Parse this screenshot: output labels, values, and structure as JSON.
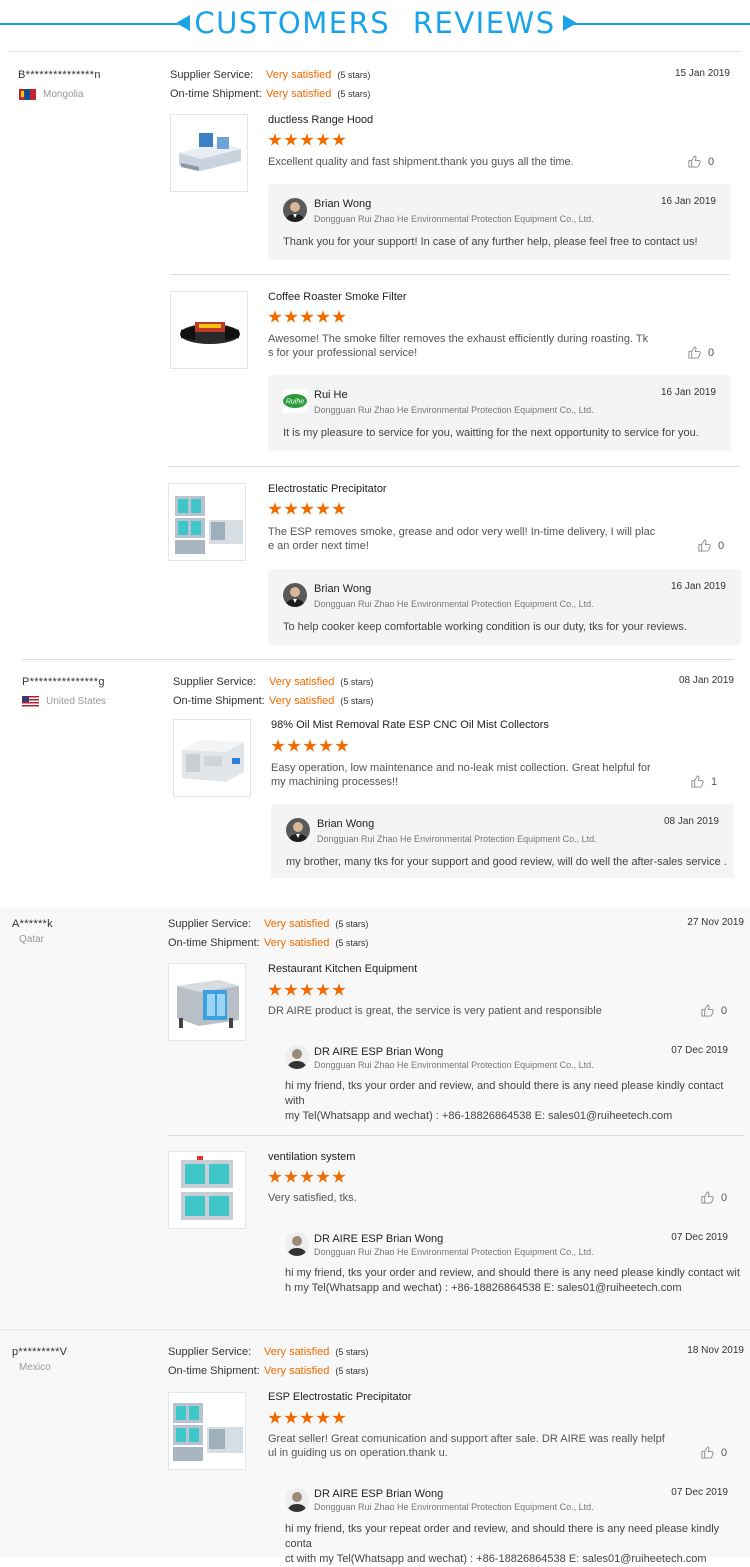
{
  "header": {
    "title": "CUSTOMERS  REVIEWS"
  },
  "labels": {
    "supplier_service": "Supplier Service:",
    "ontime_shipment": "On-time Shipment:",
    "very_satisfied": "Very satisfied",
    "five_stars": "(5 stars)"
  },
  "colors": {
    "accent_blue": "#1aa3e8",
    "accent_orange": "#ef6b00"
  },
  "reviews": [
    {
      "name": "B***************n",
      "country": "Mongolia",
      "flag": "mongolia-flag-icon",
      "date": "15 Jan 2019",
      "items": [
        {
          "product": "ductless Range Hood",
          "rating": 5,
          "comment": "Excellent quality and fast shipment.thank you guys all the time.",
          "likes": "0",
          "reply": {
            "name": "Brian Wong",
            "company": "Dongguan Rui Zhao He Environmental Protection Equipment Co., Ltd.",
            "date": "16 Jan 2019",
            "text": "Thank you  for your support! In case of any further help, please feel free to contact us!"
          }
        },
        {
          "product": "Coffee Roaster Smoke Filter",
          "rating": 5,
          "comment_l1": "Awesome! The smoke filter removes the exhaust efficiently during roasting. Tk",
          "comment_l2": "s for your professional service!",
          "likes": "0",
          "reply": {
            "name": "Rui He",
            "company": "Dongguan Rui Zhao He Environmental Protection Equipment Co., Ltd.",
            "date": "16 Jan 2019",
            "text": "It is my pleasure to service for you, waitting for the next opportunity to service for you.",
            "logo_text": "Ruihe"
          }
        },
        {
          "product": "Electrostatic Precipitator",
          "rating": 5,
          "comment_l1": "The ESP removes smoke, grease and odor very well!  In-time delivery, I will plac",
          "comment_l2": "e an order next time!",
          "likes": "0",
          "reply": {
            "name": "Brian Wong",
            "company": "Dongguan Rui Zhao He Environmental Protection Equipment Co., Ltd.",
            "date": "16 Jan 2019",
            "text": "To help cooker keep comfortable  working condition is our duty, tks for your reviews."
          }
        }
      ]
    },
    {
      "name": "P***************g",
      "country": "United States",
      "flag": "usa-flag-icon",
      "date": "08 Jan 2019",
      "items": [
        {
          "product": "98% Oil Mist Removal Rate ESP CNC Oil Mist Collectors",
          "rating": 5,
          "comment_l1": "Easy operation, low maintenance and no-leak mist collection. Great helpful for",
          "comment_l2": "my machining processes!!",
          "likes": "1",
          "reply": {
            "name": "Brian Wong",
            "company": "Dongguan Rui Zhao He Environmental Protection Equipment Co., Ltd.",
            "date": "08 Jan 2019",
            "text": "my brother, many tks for your support and good review, will do well the after-sales service ."
          }
        }
      ]
    },
    {
      "name": "A******k",
      "country": "Qatar",
      "date": "27 Nov 2019",
      "items": [
        {
          "product": "Restaurant Kitchen Equipment",
          "rating": 5,
          "comment": "DR AIRE product is great, the service is very patient and responsible",
          "likes": "0",
          "reply": {
            "name": "DR AIRE ESP Brian Wong",
            "company": "Dongguan Rui Zhao He Environmental Protection Equipment Co., Ltd.",
            "date": "07 Dec 2019",
            "text_l1": "hi my friend, tks your order and review, and should there is any need please kindly contact with",
            "text_l2": "my Tel(Whatsapp and wechat) : +86-18826864538 E: sales01@ruiheetech.com"
          }
        },
        {
          "product": "ventilation system",
          "rating": 5,
          "comment": "Very satisfied, tks.",
          "likes": "0",
          "reply": {
            "name": "DR AIRE ESP Brian Wong",
            "company": "Dongguan Rui Zhao He Environmental Protection Equipment Co., Ltd.",
            "date": "07 Dec 2019",
            "text_l1": "hi my friend, tks your  order and review, and should there is any need please kindly contact wit",
            "text_l2": "h my Tel(Whatsapp and wechat) : +86-18826864538 E: sales01@ruiheetech.com"
          }
        }
      ]
    },
    {
      "name": "p*********V",
      "country": "Mexico",
      "date": "18 Nov 2019",
      "items": [
        {
          "product": "ESP Electrostatic Precipitator",
          "rating": 5,
          "comment_l1": "Great seller! Great comunication  and support after sale. DR AIRE was really helpf",
          "comment_l2": "ul in guiding us on operation.thank u.",
          "likes": "0",
          "reply": {
            "name": "DR AIRE ESP Brian Wong",
            "company": "Dongguan Rui Zhao He Environmental Protection Equipment Co., Ltd.",
            "date": "07 Dec 2019",
            "text_l1": "hi my friend, tks your repeat order and review, and should there is any need please kindly conta",
            "text_l2": "ct with my Tel(Whatsapp and wechat) : +86-18826864538 E: sales01@ruiheetech.com"
          }
        }
      ]
    }
  ]
}
